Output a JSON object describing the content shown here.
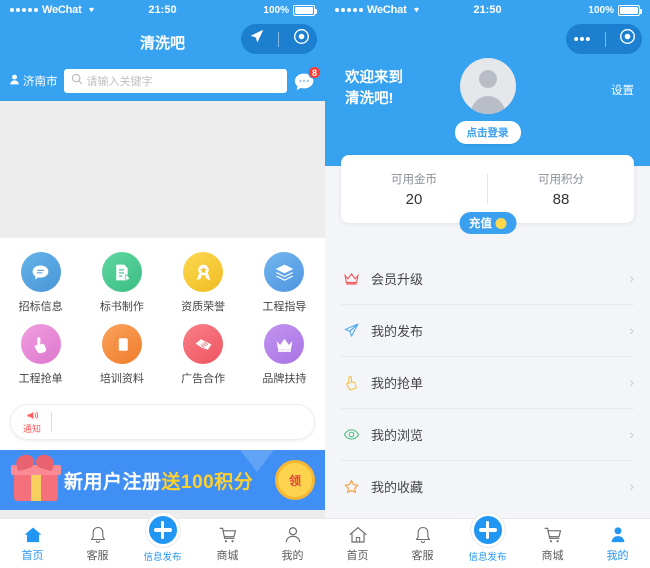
{
  "status_bar": {
    "carrier": "WeChat",
    "time": "21:50",
    "battery_percent": "100%"
  },
  "home": {
    "title": "清洗吧",
    "location": "济南市",
    "search_placeholder": "请输入关键字",
    "chat_badge": "8",
    "grid": [
      {
        "label": "招标信息",
        "icon": "speech-bubble-icon",
        "color": "#4a9fe0"
      },
      {
        "label": "标书制作",
        "icon": "document-edit-icon",
        "color": "#45c88a"
      },
      {
        "label": "资质荣誉",
        "icon": "medal-star-icon",
        "color": "#f5c431"
      },
      {
        "label": "工程指导",
        "icon": "layers-icon",
        "color": "#5aa7e8"
      },
      {
        "label": "工程抢单",
        "icon": "hand-tap-icon",
        "color": "#e57fd0"
      },
      {
        "label": "培训资料",
        "icon": "book-icon",
        "color": "#f2893c"
      },
      {
        "label": "广告合作",
        "icon": "handshake-icon",
        "color": "#f4616c"
      },
      {
        "label": "品牌扶持",
        "icon": "crown-icon",
        "color": "#b07fe8"
      }
    ],
    "notice": {
      "tag": "通知",
      "icon": "speaker-icon",
      "text": ""
    },
    "banner": {
      "text_prefix": "新用户注册",
      "text_highlight": "送100积分",
      "coin_text": "领"
    }
  },
  "profile": {
    "greeting_line1": "欢迎来到",
    "greeting_line2": "清洗吧!",
    "settings_label": "设置",
    "login_label": "点击登录",
    "balance": {
      "coins_label": "可用金币",
      "coins_value": "20",
      "points_label": "可用积分",
      "points_value": "88",
      "recharge_label": "充值"
    },
    "menu": [
      {
        "label": "会员升级",
        "icon": "crown-icon",
        "color": "#ef5b60"
      },
      {
        "label": "我的发布",
        "icon": "paper-plane-icon",
        "color": "#4fa8f0"
      },
      {
        "label": "我的抢单",
        "icon": "hand-tap-icon",
        "color": "#f5bf3e"
      },
      {
        "label": "我的浏览",
        "icon": "eye-icon",
        "color": "#3fbf7f"
      },
      {
        "label": "我的收藏",
        "icon": "star-icon",
        "color": "#f59b3c"
      }
    ]
  },
  "tabbar": {
    "items": [
      {
        "label": "首页",
        "icon": "home-icon"
      },
      {
        "label": "客服",
        "icon": "bell-icon"
      },
      {
        "label": "信息发布",
        "icon": "plus-circle-icon"
      },
      {
        "label": "商城",
        "icon": "cart-icon"
      },
      {
        "label": "我的",
        "icon": "person-icon"
      }
    ]
  },
  "colors": {
    "brand_blue": "#36a2f0",
    "accent_blue": "#2196f3",
    "notice_red": "#ff5b5b"
  }
}
